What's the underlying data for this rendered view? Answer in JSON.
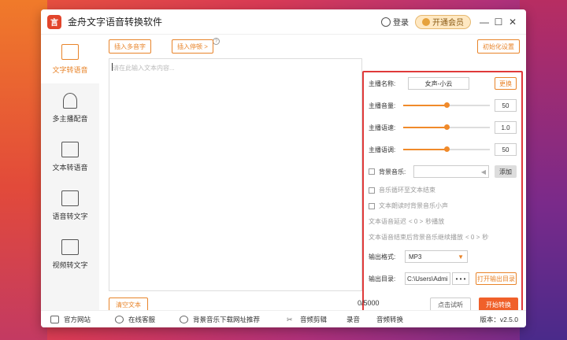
{
  "app": {
    "title": "金舟文字语音转换软件",
    "logo_text": "言",
    "login": "登录",
    "vip": "开通会员"
  },
  "window_controls": {
    "minimize": "—",
    "maximize": "☐",
    "close": "✕"
  },
  "sidebar": {
    "items": [
      {
        "label": "文字转语音",
        "active": true
      },
      {
        "label": "多主播配音",
        "active": false
      },
      {
        "label": "文本转语音",
        "active": false
      },
      {
        "label": "语音转文字",
        "active": false
      },
      {
        "label": "视频转文字",
        "active": false
      }
    ]
  },
  "toolbar": {
    "insert_polyphone": "插入多音字",
    "insert_pause": "插入停顿 >",
    "help": "?",
    "reset": "初始化设置"
  },
  "editor": {
    "placeholder": "请在此输入文本内容..."
  },
  "settings": {
    "anchor_label": "主播名称:",
    "anchor_value": "女声-小云",
    "change_btn": "更换",
    "volume_label": "主播音量:",
    "volume_value": "50",
    "volume_fraction": 0.5,
    "speed_label": "主播语速:",
    "speed_value": "1.0",
    "speed_fraction": 0.5,
    "pitch_label": "主播语调:",
    "pitch_value": "50",
    "pitch_fraction": 0.5,
    "bgm_label": "背景音乐:",
    "bgm_add": "添加",
    "loop_label": "音乐循环至文本结束",
    "duck_label": "文本朗读时背景音乐小声",
    "delay_text_a": "文本语音延迟",
    "delay_value": "< 0 >",
    "delay_text_b": "秒播放",
    "after_text_a": "文本语音结束后背景音乐继续播放",
    "after_value": "< 0 >",
    "after_text_b": "秒",
    "format_label": "输出格式:",
    "format_value": "MP3",
    "dir_label": "输出目录:",
    "dir_value": "C:\\Users\\Admi",
    "dir_more": "• • •",
    "open_dir": "打开输出目录"
  },
  "bottom": {
    "clear": "清空文本",
    "counter": "0/5000",
    "listen": "点击试听",
    "convert": "开始转换"
  },
  "footer": {
    "website": "官方网站",
    "service": "在线客服",
    "bgm_site": "背景音乐下载网址推荐",
    "audio_cut": "音频剪辑",
    "record": "录音",
    "audio_convert": "音频转换",
    "version": "版本：v2.5.0"
  },
  "colors": {
    "accent": "#e8842a",
    "primary_button": "#f0602a",
    "highlight_border": "#e03a3a"
  }
}
